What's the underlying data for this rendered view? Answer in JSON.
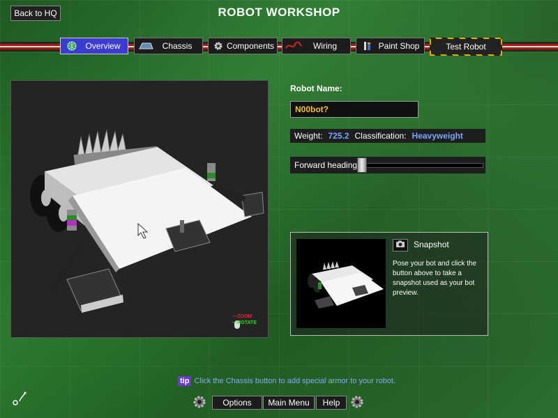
{
  "header": {
    "back_label": "Back to HQ",
    "title": "ROBOT WORKSHOP"
  },
  "tabs": [
    {
      "label": "Overview",
      "icon": "globe-icon",
      "active": true
    },
    {
      "label": "Chassis",
      "icon": "chassis-icon"
    },
    {
      "label": "Components",
      "icon": "gear-icon"
    },
    {
      "label": "Wiring",
      "icon": "wire-icon"
    },
    {
      "label": "Paint Shop",
      "icon": "paint-icon"
    },
    {
      "label": "Test Robot"
    }
  ],
  "viewport": {
    "zoom_label": "ZOOM",
    "rotate_label": "ROTATE"
  },
  "robot": {
    "name_label": "Robot Name:",
    "name_value": "N00bot?",
    "weight_label": "Weight:",
    "weight_value": "725.2",
    "class_label": "Classification:",
    "class_value": "Heavyweight",
    "heading_label": "Forward heading:",
    "heading_value": 0
  },
  "snapshot": {
    "title": "Snapshot",
    "description": "Pose your bot and click the button above to take a snapshot used as your bot preview."
  },
  "tip": {
    "badge": "tip",
    "text": "Click the Chassis button to add special armor to your robot."
  },
  "footer": {
    "options": "Options",
    "main_menu": "Main Menu",
    "help": "Help"
  },
  "colors": {
    "active_tab": "#3c3cd0",
    "name_text": "#f0c030",
    "stat_value": "#7aa6ff",
    "tip_badge": "#6a3ad0"
  }
}
